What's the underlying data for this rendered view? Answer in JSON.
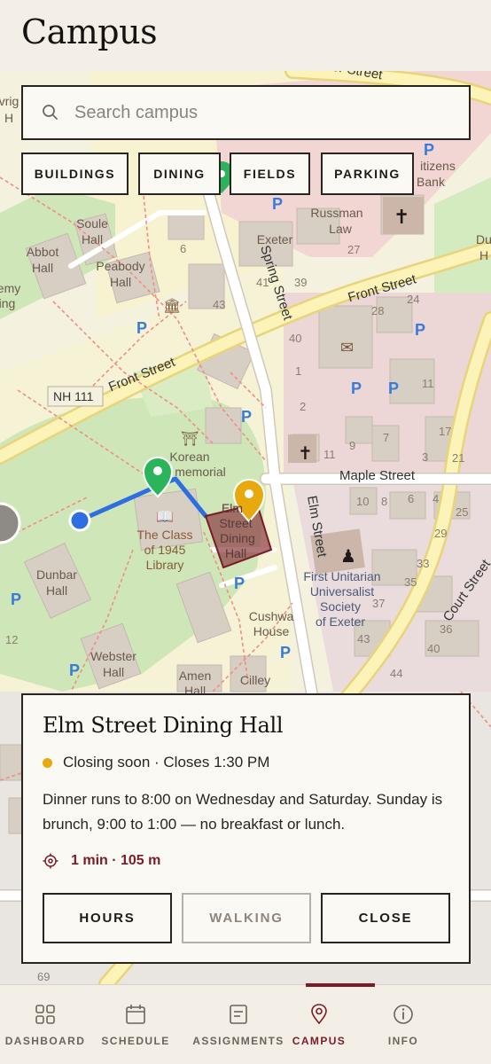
{
  "header": {
    "title": "Campus"
  },
  "search": {
    "placeholder": "Search campus",
    "value": ""
  },
  "filters": [
    {
      "label": "BUILDINGS"
    },
    {
      "label": "DINING"
    },
    {
      "label": "FIELDS"
    },
    {
      "label": "PARKING"
    }
  ],
  "map": {
    "streets": {
      "front_street_top": "Front Street",
      "front_street_left": "Front Street",
      "spring_street": "Spring Street",
      "elm_street": "Elm Street",
      "maple_street": "Maple Street",
      "court_street_top": "Court Street",
      "court_street_bottom": "Court Street",
      "nh111": "NH 111",
      "water_street": "ter Street"
    },
    "places": {
      "soule_hall": [
        "Soule",
        "Hall"
      ],
      "abbot_hall": [
        "Abbot",
        "Hall"
      ],
      "peabody_hall": [
        "Peabody",
        "Hall"
      ],
      "russman_law": [
        "Russman",
        "Law"
      ],
      "citizens_bank": [
        "itizens",
        "Bank"
      ],
      "exeter": "Exeter",
      "korean_memorial": [
        "Korean",
        "memorial"
      ],
      "library": [
        "The Class",
        "of 1945",
        "Library"
      ],
      "dining": [
        "Elm",
        "Street",
        "Dining",
        "Hall"
      ],
      "unitarian": [
        "First Unitarian",
        "Universalist",
        "Society",
        "of Exeter"
      ],
      "dunbar_hall": [
        "Dunbar",
        "Hall"
      ],
      "webster_hall": [
        "Webster",
        "Hall"
      ],
      "amen_hall": [
        "Amen",
        "Hall"
      ],
      "cilley": "Cilley",
      "cushwa_house": [
        "Cushwa",
        "House"
      ],
      "emy": [
        "emy",
        "ing"
      ],
      "vrig": [
        "vrig",
        "H"
      ],
      "du_h": [
        "Du",
        "H"
      ]
    },
    "numbers": [
      "6",
      "41",
      "39",
      "27",
      "43",
      "28",
      "24",
      "40",
      "11",
      "1",
      "2",
      "11",
      "9",
      "7",
      "3",
      "17",
      "21",
      "10",
      "8",
      "6",
      "4",
      "25",
      "29",
      "33",
      "35",
      "37",
      "36",
      "40",
      "43",
      "44",
      "12",
      "69"
    ]
  },
  "card": {
    "title": "Elm Street Dining Hall",
    "status": "Closing soon · Closes 1:30 PM",
    "status_color": "#e8a90f",
    "description": "Dinner runs to 8:00 on Wednesday and Saturday. Sunday is brunch, 9:00 to 1:00 — no breakfast or lunch.",
    "distance": "1 min · 105 m",
    "buttons": {
      "hours": "HOURS",
      "walking": "WALKING",
      "close": "CLOSE"
    }
  },
  "nav": {
    "items": [
      {
        "label": "DASHBOARD",
        "icon": "grid-icon"
      },
      {
        "label": "SCHEDULE",
        "icon": "calendar-icon"
      },
      {
        "label": "ASSIGNMENTS",
        "icon": "document-icon"
      },
      {
        "label": "CAMPUS",
        "icon": "location-pin-icon"
      },
      {
        "label": "INFO",
        "icon": "info-icon"
      }
    ],
    "active": "CAMPUS"
  },
  "colors": {
    "accent": "#7a1c26",
    "route": "#2d6fe0",
    "origin_marker": "#2bb45c",
    "destination_marker": "#e8a90f",
    "background": "#f3efe6"
  }
}
